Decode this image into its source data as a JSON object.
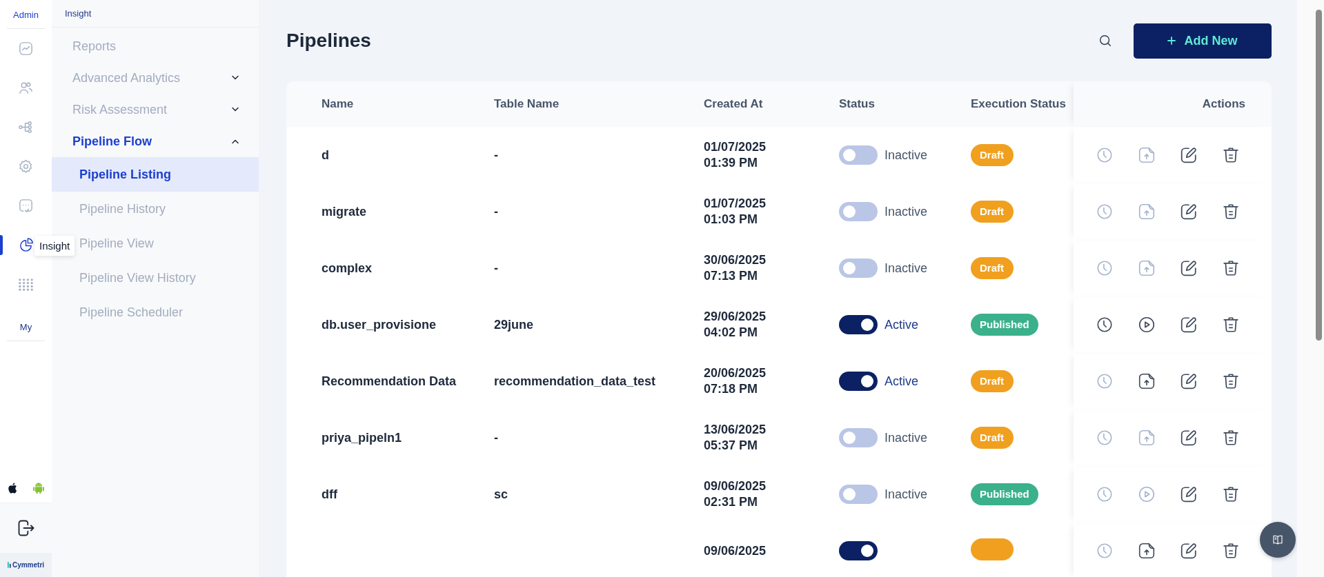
{
  "rail": {
    "top_label": "Admin",
    "items": [
      {
        "selected": false
      },
      {
        "selected": false
      },
      {
        "selected": false
      },
      {
        "selected": false
      },
      {
        "selected": false
      },
      {
        "selected": true
      },
      {
        "selected": false
      }
    ],
    "bottom_label": "My",
    "tooltip": "Insight",
    "logo": "Cymmetri"
  },
  "sidebar": {
    "title": "Insight",
    "items": [
      {
        "label": "Reports",
        "selected": false
      },
      {
        "label": "Advanced Analytics",
        "selected": false,
        "expanded": false
      },
      {
        "label": "Risk Assessment",
        "selected": false,
        "expanded": false
      },
      {
        "label": "Pipeline Flow",
        "selected": true,
        "expanded": true,
        "children": [
          {
            "label": "Pipeline Listing",
            "selected": true
          },
          {
            "label": "Pipeline History",
            "selected": false
          },
          {
            "label": "Pipeline View",
            "selected": false
          },
          {
            "label": "Pipeline View History",
            "selected": false
          },
          {
            "label": "Pipeline Scheduler",
            "selected": false
          }
        ]
      }
    ]
  },
  "page": {
    "title": "Pipelines",
    "add_button": "Add New"
  },
  "table": {
    "columns": [
      "Name",
      "Table Name",
      "Created At",
      "Status",
      "Execution Status",
      "Actions"
    ],
    "rows": [
      {
        "name": "d",
        "table_name": "-",
        "created_date": "01/07/2025",
        "created_time": "01:39 PM",
        "status": {
          "on": false,
          "label": "Inactive"
        },
        "execution_status": {
          "label": "Draft",
          "color": "#f0a01e"
        },
        "actions": [
          {
            "kind": "schedule",
            "enabled": false
          },
          {
            "kind": "publish",
            "enabled": false
          },
          {
            "kind": "edit",
            "enabled": true
          },
          {
            "kind": "delete",
            "enabled": true
          }
        ]
      },
      {
        "name": "migrate",
        "table_name": "-",
        "created_date": "01/07/2025",
        "created_time": "01:03 PM",
        "status": {
          "on": false,
          "label": "Inactive"
        },
        "execution_status": {
          "label": "Draft",
          "color": "#f0a01e"
        },
        "actions": [
          {
            "kind": "schedule",
            "enabled": false
          },
          {
            "kind": "publish",
            "enabled": false
          },
          {
            "kind": "edit",
            "enabled": true
          },
          {
            "kind": "delete",
            "enabled": true
          }
        ]
      },
      {
        "name": "complex",
        "table_name": "-",
        "created_date": "30/06/2025",
        "created_time": "07:13 PM",
        "status": {
          "on": false,
          "label": "Inactive"
        },
        "execution_status": {
          "label": "Draft",
          "color": "#f0a01e"
        },
        "actions": [
          {
            "kind": "schedule",
            "enabled": false
          },
          {
            "kind": "publish",
            "enabled": false
          },
          {
            "kind": "edit",
            "enabled": true
          },
          {
            "kind": "delete",
            "enabled": true
          }
        ]
      },
      {
        "name": "db.user_provisione",
        "table_name": "29june",
        "created_date": "29/06/2025",
        "created_time": "04:02 PM",
        "status": {
          "on": true,
          "label": "Active"
        },
        "execution_status": {
          "label": "Published",
          "color": "#3bb18b"
        },
        "actions": [
          {
            "kind": "schedule",
            "enabled": true
          },
          {
            "kind": "run",
            "enabled": true
          },
          {
            "kind": "edit",
            "enabled": true
          },
          {
            "kind": "delete",
            "enabled": true
          }
        ]
      },
      {
        "name": "Recommendation Data",
        "table_name": "recommendation_data_test",
        "created_date": "20/06/2025",
        "created_time": "07:18 PM",
        "status": {
          "on": true,
          "label": "Active"
        },
        "execution_status": {
          "label": "Draft",
          "color": "#f0a01e"
        },
        "actions": [
          {
            "kind": "schedule",
            "enabled": false
          },
          {
            "kind": "publish",
            "enabled": true
          },
          {
            "kind": "edit",
            "enabled": true
          },
          {
            "kind": "delete",
            "enabled": true
          }
        ]
      },
      {
        "name": "priya_pipeln1",
        "table_name": "-",
        "created_date": "13/06/2025",
        "created_time": "05:37 PM",
        "status": {
          "on": false,
          "label": "Inactive"
        },
        "execution_status": {
          "label": "Draft",
          "color": "#f0a01e"
        },
        "actions": [
          {
            "kind": "schedule",
            "enabled": false
          },
          {
            "kind": "publish",
            "enabled": false
          },
          {
            "kind": "edit",
            "enabled": true
          },
          {
            "kind": "delete",
            "enabled": true
          }
        ]
      },
      {
        "name": "dff",
        "table_name": "sc",
        "created_date": "09/06/2025",
        "created_time": "02:31 PM",
        "status": {
          "on": false,
          "label": "Inactive"
        },
        "execution_status": {
          "label": "Published",
          "color": "#3bb18b"
        },
        "actions": [
          {
            "kind": "schedule",
            "enabled": false
          },
          {
            "kind": "run",
            "enabled": false
          },
          {
            "kind": "edit",
            "enabled": true
          },
          {
            "kind": "delete",
            "enabled": true
          }
        ]
      },
      {
        "created_date": "09/06/2025",
        "status": {
          "on": true
        },
        "execution_status": {
          "color": "#f0a01e"
        },
        "actions": [
          {
            "kind": "schedule",
            "enabled": false
          },
          {
            "kind": "publish",
            "enabled": true
          },
          {
            "kind": "edit",
            "enabled": true
          },
          {
            "kind": "delete",
            "enabled": true
          }
        ]
      }
    ]
  }
}
